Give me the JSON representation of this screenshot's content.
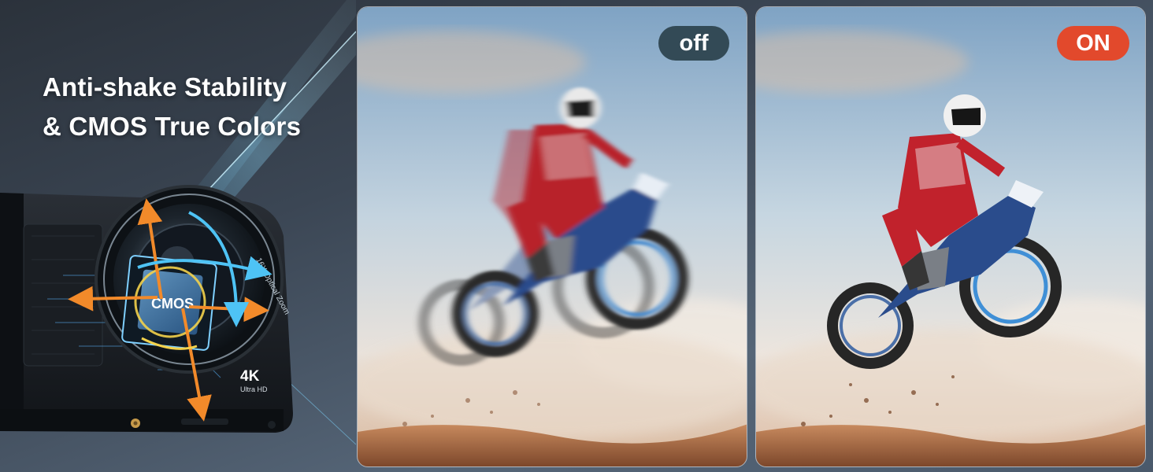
{
  "headline": {
    "line1": "Anti-shake Stability",
    "line2": "& CMOS True Colors"
  },
  "camera": {
    "sensor_label": "CMOS",
    "resolution_badge": "4K",
    "resolution_sub": "Ultra HD",
    "lens_ring_text": "16X Optical Zoom"
  },
  "comparison": {
    "off_label": "off",
    "on_label": "ON"
  },
  "colors": {
    "off_badge": "#334a56",
    "on_badge": "#e2492c",
    "arrow_orange": "#f28a2a",
    "arrow_blue": "#4ec3f5"
  }
}
